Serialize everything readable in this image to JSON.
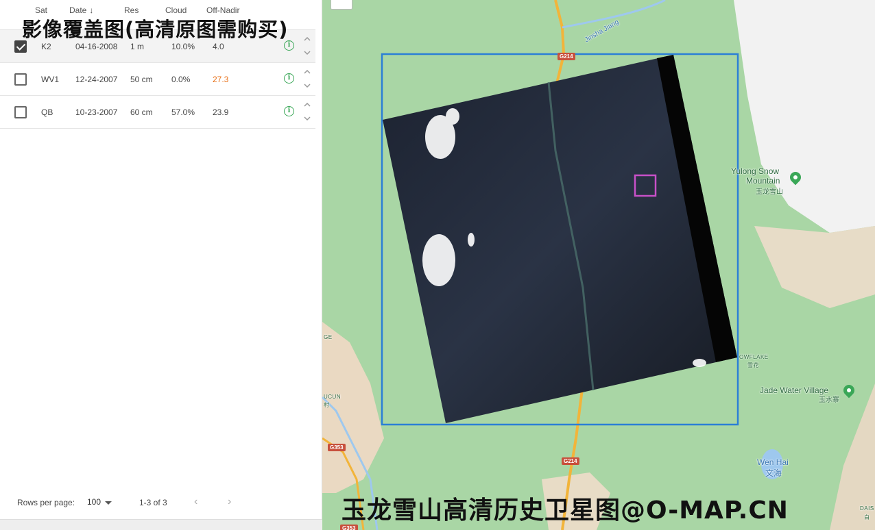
{
  "overlay_top_text": "影像覆盖图(高清原图需购买)",
  "overlay_bottom_text": "玉龙雪山高清历史卫星图@O-MAP.CN",
  "table": {
    "headers": {
      "sat": "Sat",
      "date": "Date",
      "res": "Res",
      "cloud": "Cloud",
      "off_nadir": "Off-Nadir"
    },
    "sort_icon": "arrow-down-icon",
    "rows": [
      {
        "selected": true,
        "sat": "K2",
        "date": "04-16-2008",
        "res": "1 m",
        "cloud": "10.0%",
        "off_nadir": "4.0",
        "off_nadir_warn": false
      },
      {
        "selected": false,
        "sat": "WV1",
        "date": "12-24-2007",
        "res": "50 cm",
        "cloud": "0.0%",
        "off_nadir": "27.3",
        "off_nadir_warn": true
      },
      {
        "selected": false,
        "sat": "QB",
        "date": "10-23-2007",
        "res": "60 cm",
        "cloud": "57.0%",
        "off_nadir": "23.9",
        "off_nadir_warn": false
      }
    ],
    "info_glyph": "i"
  },
  "footer": {
    "rows_per_page_label": "Rows per page:",
    "rows_per_page_value": "100",
    "range": "1-3 of 3",
    "prev_glyph": "‹",
    "next_glyph": "›"
  },
  "map": {
    "labels": {
      "jinsha": "Jinsha Jiang",
      "yulong_en": "Yulong Snow",
      "yulong_en2": "Mountain",
      "yulong_cn": "玉龙雪山",
      "snowflake": "OWFLAKE",
      "snowflake_cn": "雪花",
      "jade_en": "Jade Water Village",
      "jade_cn": "玉水寨",
      "wenhai_en": "Wen Hai",
      "wenhai_cn": "文海",
      "ucun": "UCUN",
      "ucun_cn": "村",
      "ge": "GE",
      "g214_top": "G214",
      "g214_bottom": "G214",
      "g353": "G353",
      "g353_bottom": "G353",
      "dais": "DAIS",
      "dais_cn": "白"
    },
    "colors": {
      "footprint_outline": "#2b7fd6",
      "aoi_outline": "#c850c8",
      "forest": "#a8d5a4",
      "snow": "#f4f4f4",
      "valley": "#e8dcc8",
      "road": "#f0b43c",
      "water": "#9ec8ee"
    }
  }
}
